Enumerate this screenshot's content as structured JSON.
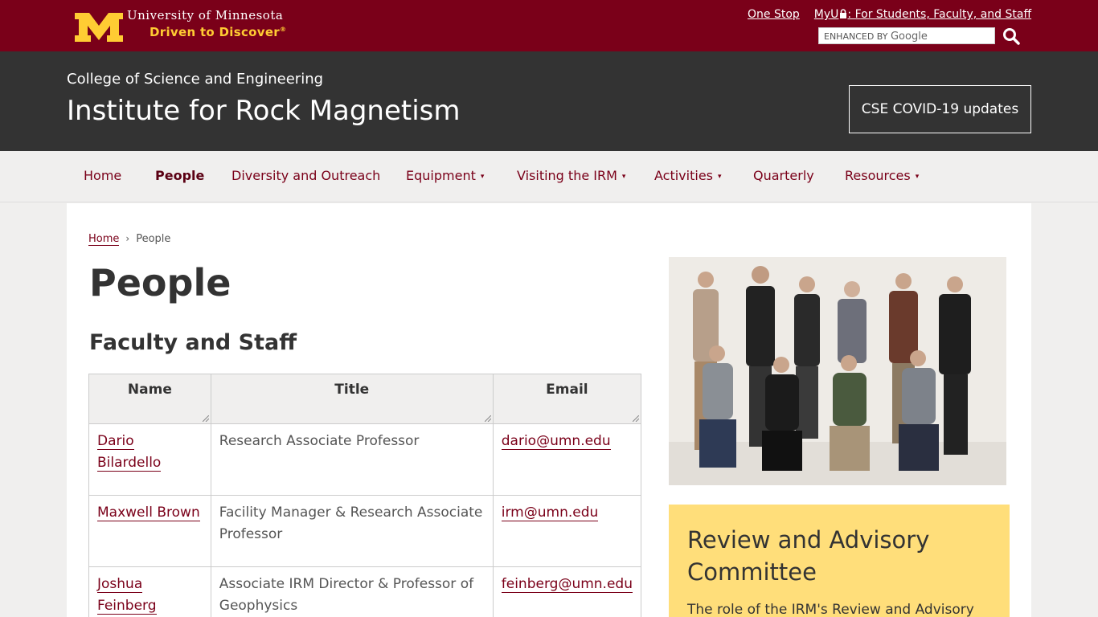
{
  "brand": {
    "university": "University of Minnesota",
    "tagline": "Driven to Discover",
    "tagline_mark": "®",
    "colors": {
      "maroon": "#7a0019",
      "gold": "#ffcc33",
      "dark": "#333333",
      "callout": "#ffde7a"
    }
  },
  "toplinks": {
    "one_stop": "One Stop",
    "myu_prefix": "MyU",
    "myu_suffix": ": For Students, Faculty, and Staff",
    "search_label": "ENHANCED BY",
    "search_brand": "Google"
  },
  "header": {
    "college": "College of Science and Engineering",
    "site_title": "Institute for Rock Magnetism",
    "covid_button": "CSE COVID-19 updates"
  },
  "nav": {
    "items": [
      {
        "label": "Home",
        "dropdown": false
      },
      {
        "label": "People",
        "dropdown": false,
        "active": true
      },
      {
        "label": "Diversity and Outreach",
        "dropdown": false
      },
      {
        "label": "Equipment",
        "dropdown": true
      },
      {
        "label": "Visiting the IRM",
        "dropdown": true
      },
      {
        "label": "Activities",
        "dropdown": true
      },
      {
        "label": "Quarterly",
        "dropdown": false
      },
      {
        "label": "Resources",
        "dropdown": true
      }
    ],
    "caret": "▾"
  },
  "breadcrumb": {
    "home": "Home",
    "sep": "›",
    "current": "People"
  },
  "page": {
    "title": "People",
    "section": "Faculty and Staff"
  },
  "table": {
    "headers": [
      "Name",
      "Title",
      "Email"
    ],
    "rows": [
      {
        "name_1": "Dario",
        "name_2": "Bilardello",
        "title": "Research Associate Professor",
        "email": "dario@umn.edu"
      },
      {
        "name_1": "Maxwell Brown",
        "name_2": "",
        "title": "Facility Manager & Research Associate Professor",
        "email": "irm@umn.edu"
      },
      {
        "name_1": "Joshua",
        "name_2": "Feinberg",
        "title": "Associate IRM Director & Professor of Geophysics",
        "email": "feinberg@umn.edu"
      }
    ]
  },
  "callout": {
    "heading": "Review and Advisory Committee",
    "text": "The role of the IRM's Review and Advisory"
  }
}
